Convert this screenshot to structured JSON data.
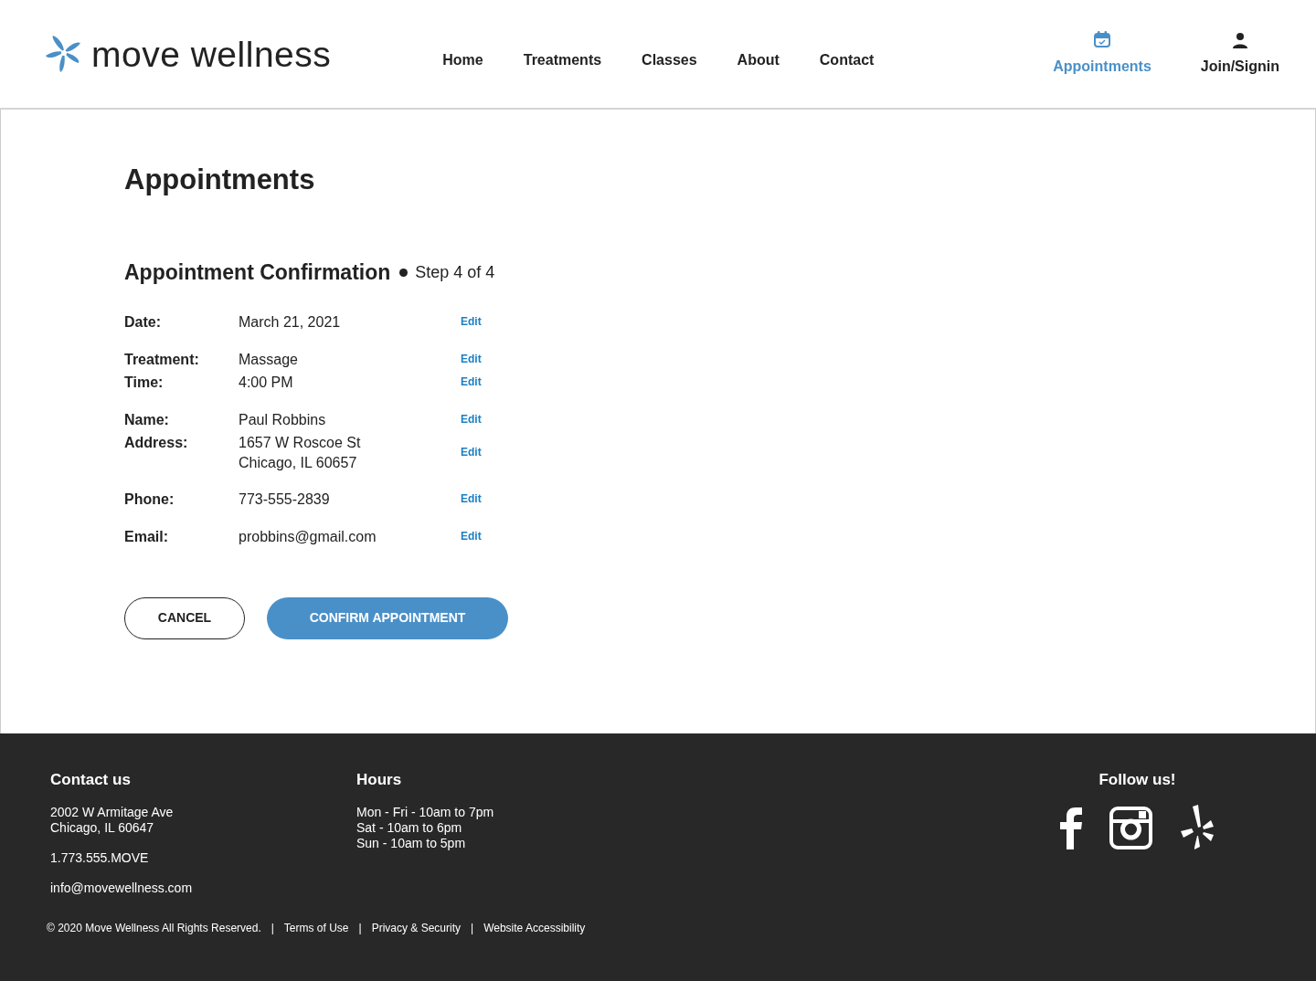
{
  "brand": {
    "name": "move wellness"
  },
  "nav": [
    {
      "label": "Home",
      "selected": false
    },
    {
      "label": "Treatments",
      "selected": false
    },
    {
      "label": "Classes",
      "selected": false
    },
    {
      "label": "About",
      "selected": false
    },
    {
      "label": "Contact",
      "selected": false
    }
  ],
  "account_nav": [
    {
      "label": "Appointments",
      "kind": "calendar",
      "selected": true
    },
    {
      "label": "Join/Signin",
      "kind": "person",
      "selected": false
    }
  ],
  "page_title": "Appointments",
  "section": {
    "title": "Appointment Confirmation",
    "step": "Step 4 of 4"
  },
  "details": [
    [
      {
        "label": "Date:",
        "lines": [
          "March 21, 2021"
        ],
        "edit": "Edit"
      }
    ],
    [
      {
        "label": "Treatment:",
        "lines": [
          "Massage"
        ],
        "edit": "Edit"
      },
      {
        "label": "Time:",
        "lines": [
          "4:00 PM"
        ],
        "edit": "Edit"
      }
    ],
    [
      {
        "label": "Name:",
        "lines": [
          "Paul Robbins"
        ],
        "edit": "Edit"
      },
      {
        "label": "Address:",
        "lines": [
          "1657 W Roscoe St",
          "Chicago, IL 60657"
        ],
        "edit": "Edit"
      }
    ],
    [
      {
        "label": "Phone:",
        "lines": [
          "773-555-2839"
        ],
        "edit": "Edit"
      }
    ],
    [
      {
        "label": "Email:",
        "lines": [
          "probbins@gmail.com"
        ],
        "edit": "Edit"
      }
    ]
  ],
  "buttons": [
    {
      "label": "CANCEL",
      "kind": "outline"
    },
    {
      "label": "CONFIRM APPOINTMENT",
      "kind": "primary"
    }
  ],
  "footer": {
    "contact": {
      "title": "Contact us",
      "address": [
        "2002 W Armitage Ave",
        "Chicago, IL 60647"
      ],
      "phone": "1.773.555.MOVE",
      "email": "info@movewellness.com"
    },
    "hours": {
      "title": "Hours",
      "lines": [
        "Mon - Fri - 10am to 7pm",
        "Sat - 10am to 6pm",
        "Sun - 10am to 5pm"
      ]
    },
    "social": {
      "title": "Follow us!",
      "icons": [
        {
          "kind": "facebook"
        },
        {
          "kind": "instagram"
        },
        {
          "kind": "yelp"
        }
      ]
    },
    "legal": {
      "copyright": "© 2020 Move Wellness All Rights Reserved.",
      "separator": "|",
      "links": [
        "Terms of Use",
        "Privacy & Security",
        "Website Accessibility"
      ]
    }
  }
}
